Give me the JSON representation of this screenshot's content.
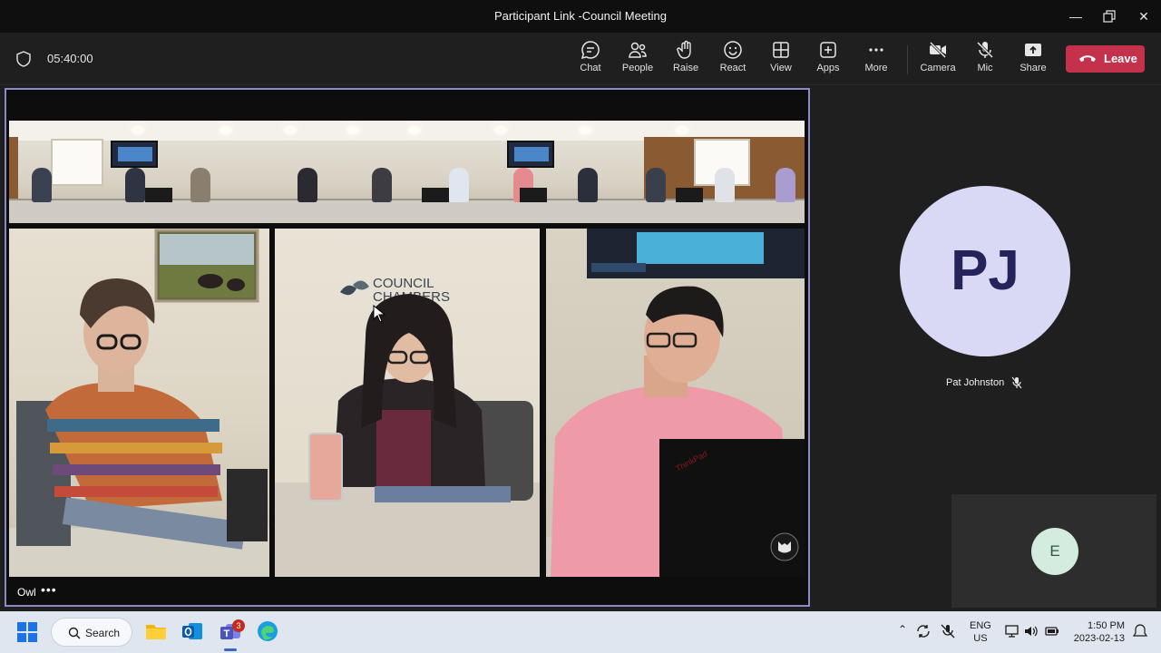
{
  "window": {
    "title": "Participant Link -Council Meeting"
  },
  "meeting": {
    "timer": "05:40:00"
  },
  "toolbar": {
    "chat": "Chat",
    "people": "People",
    "raise": "Raise",
    "react": "React",
    "view": "View",
    "apps": "Apps",
    "more": "More",
    "camera": "Camera",
    "mic": "Mic",
    "share": "Share",
    "leave": "Leave"
  },
  "stage": {
    "name": "Owl",
    "more": "•••",
    "sign": [
      "COUNCIL",
      "CHAMBERS"
    ]
  },
  "participants": {
    "pj": {
      "initials": "PJ",
      "name": "Pat Johnston",
      "muted": true
    },
    "self": {
      "initials": "E"
    }
  },
  "taskbar": {
    "search": "Search",
    "teams_badge": "3",
    "lang_top": "ENG",
    "lang_bottom": "US",
    "time": "1:50 PM",
    "date": "2023-02-13"
  },
  "colors": {
    "accent": "#8b8cc7",
    "leave": "#c4314b"
  }
}
